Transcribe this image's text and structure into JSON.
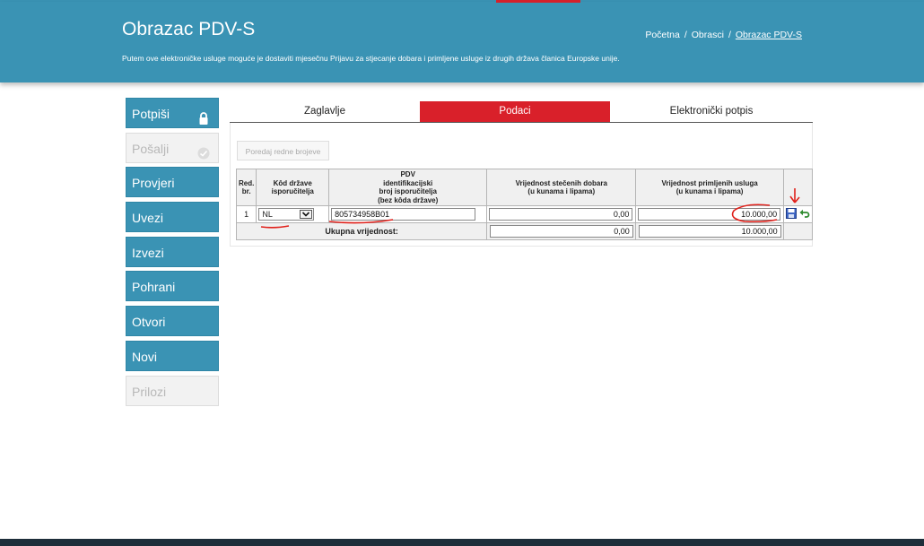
{
  "header": {
    "title": "Obrazac PDV-S",
    "subtitle": "Putem ove elektroničke usluge moguće je dostaviti mjesečnu Prijavu za stjecanje dobara i primljene usluge iz drugih država članica Europske unije.",
    "breadcrumb": [
      "Početna",
      "Obrasci",
      "Obrazac PDV-S"
    ],
    "breadcrumb_sep": "/"
  },
  "sidebar": {
    "items": [
      {
        "label": "Potpiši",
        "icon": "lock-icon",
        "enabled": true
      },
      {
        "label": "Pošalji",
        "icon": "send-icon",
        "enabled": false
      },
      {
        "label": "Provjeri",
        "enabled": true
      },
      {
        "label": "Uvezi",
        "enabled": true
      },
      {
        "label": "Izvezi",
        "enabled": true
      },
      {
        "label": "Pohrani",
        "enabled": true
      },
      {
        "label": "Otvori",
        "enabled": true
      },
      {
        "label": "Novi",
        "enabled": true
      },
      {
        "label": "Prilozi",
        "enabled": false
      }
    ]
  },
  "tabs": [
    {
      "label": "Zaglavlje",
      "active": false
    },
    {
      "label": "Podaci",
      "active": true
    },
    {
      "label": "Elektronički potpis",
      "active": false
    }
  ],
  "toolbar": {
    "sort_label": "Poredaj redne brojeve"
  },
  "table": {
    "headers": {
      "rb": [
        "Red.",
        "br."
      ],
      "country": [
        "Kôd države",
        "isporučitelja"
      ],
      "vat": [
        "PDV",
        "identifikacijski",
        "broj isporučitelja",
        "(bez kôda države)"
      ],
      "goods": [
        "Vrijednost stečenih dobara",
        "(u kunama i lipama)"
      ],
      "services": [
        "Vrijednost primljenih usluga",
        "(u kunama i lipama)"
      ]
    },
    "rows": [
      {
        "rb": "1",
        "country": "NL",
        "vat": "805734958B01",
        "goods": "0,00",
        "services": "10.000,00"
      }
    ],
    "total": {
      "label": "Ukupna vrijednost:",
      "goods": "0,00",
      "services": "10.000,00"
    }
  },
  "colors": {
    "header_bg": "#3a93b4",
    "active_tab": "#d9202a",
    "annotation": "#e0201a"
  }
}
